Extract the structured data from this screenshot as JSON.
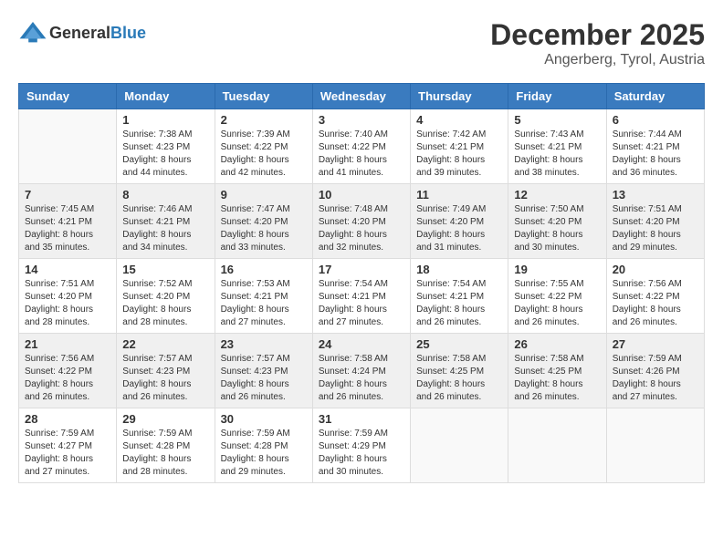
{
  "header": {
    "logo_general": "General",
    "logo_blue": "Blue",
    "month_year": "December 2025",
    "location": "Angerberg, Tyrol, Austria"
  },
  "days_of_week": [
    "Sunday",
    "Monday",
    "Tuesday",
    "Wednesday",
    "Thursday",
    "Friday",
    "Saturday"
  ],
  "weeks": [
    [
      {
        "day": "",
        "sunrise": "",
        "sunset": "",
        "daylight": ""
      },
      {
        "day": "1",
        "sunrise": "Sunrise: 7:38 AM",
        "sunset": "Sunset: 4:23 PM",
        "daylight": "Daylight: 8 hours and 44 minutes."
      },
      {
        "day": "2",
        "sunrise": "Sunrise: 7:39 AM",
        "sunset": "Sunset: 4:22 PM",
        "daylight": "Daylight: 8 hours and 42 minutes."
      },
      {
        "day": "3",
        "sunrise": "Sunrise: 7:40 AM",
        "sunset": "Sunset: 4:22 PM",
        "daylight": "Daylight: 8 hours and 41 minutes."
      },
      {
        "day": "4",
        "sunrise": "Sunrise: 7:42 AM",
        "sunset": "Sunset: 4:21 PM",
        "daylight": "Daylight: 8 hours and 39 minutes."
      },
      {
        "day": "5",
        "sunrise": "Sunrise: 7:43 AM",
        "sunset": "Sunset: 4:21 PM",
        "daylight": "Daylight: 8 hours and 38 minutes."
      },
      {
        "day": "6",
        "sunrise": "Sunrise: 7:44 AM",
        "sunset": "Sunset: 4:21 PM",
        "daylight": "Daylight: 8 hours and 36 minutes."
      }
    ],
    [
      {
        "day": "7",
        "sunrise": "Sunrise: 7:45 AM",
        "sunset": "Sunset: 4:21 PM",
        "daylight": "Daylight: 8 hours and 35 minutes."
      },
      {
        "day": "8",
        "sunrise": "Sunrise: 7:46 AM",
        "sunset": "Sunset: 4:21 PM",
        "daylight": "Daylight: 8 hours and 34 minutes."
      },
      {
        "day": "9",
        "sunrise": "Sunrise: 7:47 AM",
        "sunset": "Sunset: 4:20 PM",
        "daylight": "Daylight: 8 hours and 33 minutes."
      },
      {
        "day": "10",
        "sunrise": "Sunrise: 7:48 AM",
        "sunset": "Sunset: 4:20 PM",
        "daylight": "Daylight: 8 hours and 32 minutes."
      },
      {
        "day": "11",
        "sunrise": "Sunrise: 7:49 AM",
        "sunset": "Sunset: 4:20 PM",
        "daylight": "Daylight: 8 hours and 31 minutes."
      },
      {
        "day": "12",
        "sunrise": "Sunrise: 7:50 AM",
        "sunset": "Sunset: 4:20 PM",
        "daylight": "Daylight: 8 hours and 30 minutes."
      },
      {
        "day": "13",
        "sunrise": "Sunrise: 7:51 AM",
        "sunset": "Sunset: 4:20 PM",
        "daylight": "Daylight: 8 hours and 29 minutes."
      }
    ],
    [
      {
        "day": "14",
        "sunrise": "Sunrise: 7:51 AM",
        "sunset": "Sunset: 4:20 PM",
        "daylight": "Daylight: 8 hours and 28 minutes."
      },
      {
        "day": "15",
        "sunrise": "Sunrise: 7:52 AM",
        "sunset": "Sunset: 4:20 PM",
        "daylight": "Daylight: 8 hours and 28 minutes."
      },
      {
        "day": "16",
        "sunrise": "Sunrise: 7:53 AM",
        "sunset": "Sunset: 4:21 PM",
        "daylight": "Daylight: 8 hours and 27 minutes."
      },
      {
        "day": "17",
        "sunrise": "Sunrise: 7:54 AM",
        "sunset": "Sunset: 4:21 PM",
        "daylight": "Daylight: 8 hours and 27 minutes."
      },
      {
        "day": "18",
        "sunrise": "Sunrise: 7:54 AM",
        "sunset": "Sunset: 4:21 PM",
        "daylight": "Daylight: 8 hours and 26 minutes."
      },
      {
        "day": "19",
        "sunrise": "Sunrise: 7:55 AM",
        "sunset": "Sunset: 4:22 PM",
        "daylight": "Daylight: 8 hours and 26 minutes."
      },
      {
        "day": "20",
        "sunrise": "Sunrise: 7:56 AM",
        "sunset": "Sunset: 4:22 PM",
        "daylight": "Daylight: 8 hours and 26 minutes."
      }
    ],
    [
      {
        "day": "21",
        "sunrise": "Sunrise: 7:56 AM",
        "sunset": "Sunset: 4:22 PM",
        "daylight": "Daylight: 8 hours and 26 minutes."
      },
      {
        "day": "22",
        "sunrise": "Sunrise: 7:57 AM",
        "sunset": "Sunset: 4:23 PM",
        "daylight": "Daylight: 8 hours and 26 minutes."
      },
      {
        "day": "23",
        "sunrise": "Sunrise: 7:57 AM",
        "sunset": "Sunset: 4:23 PM",
        "daylight": "Daylight: 8 hours and 26 minutes."
      },
      {
        "day": "24",
        "sunrise": "Sunrise: 7:58 AM",
        "sunset": "Sunset: 4:24 PM",
        "daylight": "Daylight: 8 hours and 26 minutes."
      },
      {
        "day": "25",
        "sunrise": "Sunrise: 7:58 AM",
        "sunset": "Sunset: 4:25 PM",
        "daylight": "Daylight: 8 hours and 26 minutes."
      },
      {
        "day": "26",
        "sunrise": "Sunrise: 7:58 AM",
        "sunset": "Sunset: 4:25 PM",
        "daylight": "Daylight: 8 hours and 26 minutes."
      },
      {
        "day": "27",
        "sunrise": "Sunrise: 7:59 AM",
        "sunset": "Sunset: 4:26 PM",
        "daylight": "Daylight: 8 hours and 27 minutes."
      }
    ],
    [
      {
        "day": "28",
        "sunrise": "Sunrise: 7:59 AM",
        "sunset": "Sunset: 4:27 PM",
        "daylight": "Daylight: 8 hours and 27 minutes."
      },
      {
        "day": "29",
        "sunrise": "Sunrise: 7:59 AM",
        "sunset": "Sunset: 4:28 PM",
        "daylight": "Daylight: 8 hours and 28 minutes."
      },
      {
        "day": "30",
        "sunrise": "Sunrise: 7:59 AM",
        "sunset": "Sunset: 4:28 PM",
        "daylight": "Daylight: 8 hours and 29 minutes."
      },
      {
        "day": "31",
        "sunrise": "Sunrise: 7:59 AM",
        "sunset": "Sunset: 4:29 PM",
        "daylight": "Daylight: 8 hours and 30 minutes."
      },
      {
        "day": "",
        "sunrise": "",
        "sunset": "",
        "daylight": ""
      },
      {
        "day": "",
        "sunrise": "",
        "sunset": "",
        "daylight": ""
      },
      {
        "day": "",
        "sunrise": "",
        "sunset": "",
        "daylight": ""
      }
    ]
  ]
}
